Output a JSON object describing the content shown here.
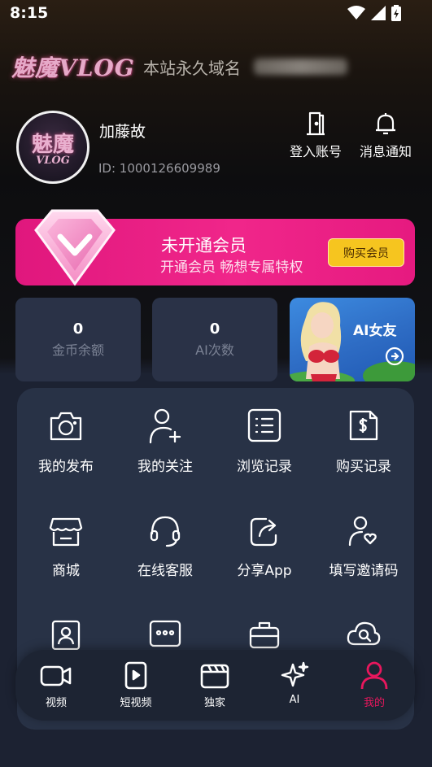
{
  "status_bar": {
    "time": "8:15",
    "icons": [
      "wifi-icon",
      "signal-icon",
      "battery-charging-icon"
    ]
  },
  "header": {
    "logo_text": "魅魔VLOG",
    "domain_label": "本站永久域名"
  },
  "profile": {
    "avatar_line1": "魅魔",
    "avatar_line2": "VLOG",
    "username": "加藤故",
    "user_id": "ID: 1000126609989",
    "actions": [
      {
        "label": "登入账号",
        "icon": "door-icon"
      },
      {
        "label": "消息通知",
        "icon": "bell-icon"
      }
    ]
  },
  "vip": {
    "title": "未开通会员",
    "subtitle": "开通会员 畅想专属特权",
    "button": "购买会员",
    "colors": {
      "banner": "#e91c82",
      "button": "#f6c51f"
    }
  },
  "stats": [
    {
      "value": "0",
      "label": "金币余额"
    },
    {
      "value": "0",
      "label": "AI次数"
    }
  ],
  "ai_card": {
    "label": "AI女友"
  },
  "menu": [
    {
      "label": "我的发布",
      "icon": "camera-icon"
    },
    {
      "label": "我的关注",
      "icon": "user-plus-icon"
    },
    {
      "label": "浏览记录",
      "icon": "list-icon"
    },
    {
      "label": "购买记录",
      "icon": "receipt-icon"
    },
    {
      "label": "商城",
      "icon": "store-icon"
    },
    {
      "label": "在线客服",
      "icon": "headset-icon"
    },
    {
      "label": "分享App",
      "icon": "share-icon"
    },
    {
      "label": "填写邀请码",
      "icon": "user-heart-icon"
    },
    {
      "label": "",
      "icon": "contact-card-icon"
    },
    {
      "label": "",
      "icon": "group-icon"
    },
    {
      "label": "",
      "icon": "briefcase-icon"
    },
    {
      "label": "",
      "icon": "cloud-search-icon"
    }
  ],
  "bottom_nav": [
    {
      "label": "视频",
      "icon": "video-icon",
      "active": false
    },
    {
      "label": "短视频",
      "icon": "short-video-icon",
      "active": false
    },
    {
      "label": "独家",
      "icon": "clapper-icon",
      "active": false
    },
    {
      "label": "AI",
      "icon": "sparkle-icon",
      "active": false
    },
    {
      "label": "我的",
      "icon": "user-icon",
      "active": true
    }
  ],
  "colors": {
    "accent_active": "#e8175d",
    "panel": "#283246",
    "background": "#1c2232"
  }
}
